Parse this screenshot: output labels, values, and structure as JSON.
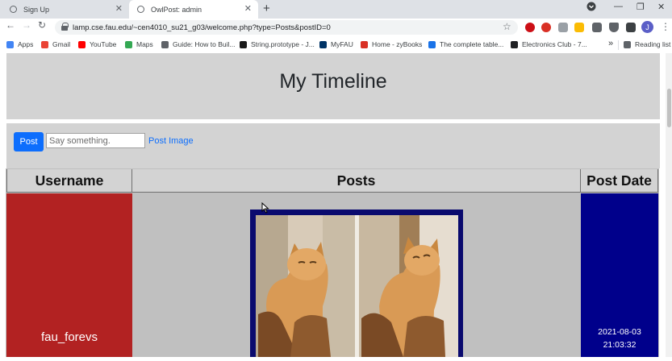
{
  "browser": {
    "tabs": [
      {
        "title": "Sign Up"
      },
      {
        "title": "OwlPost: admin"
      }
    ],
    "url": "lamp.cse.fau.edu/~cen4010_su21_g03/welcome.php?type=Posts&postID=0",
    "bookmarks": [
      {
        "label": "Apps",
        "icon": "apps-grid-icon",
        "color": "#4285f4"
      },
      {
        "label": "Gmail",
        "icon": "gmail-icon",
        "color": "#ea4335"
      },
      {
        "label": "YouTube",
        "icon": "youtube-icon",
        "color": "#ff0000"
      },
      {
        "label": "Maps",
        "icon": "maps-icon",
        "color": "#34a853"
      },
      {
        "label": "Guide: How to Buil...",
        "icon": "guide-icon",
        "color": "#5f6368"
      },
      {
        "label": "String.prototype - J...",
        "icon": "mdn-icon",
        "color": "#1a1a1a"
      },
      {
        "label": "MyFAU",
        "icon": "owl-icon",
        "color": "#003366"
      },
      {
        "label": "Home - zyBooks",
        "icon": "zybooks-icon",
        "color": "#d93025"
      },
      {
        "label": "The complete table...",
        "icon": "bookmark-icon",
        "color": "#1a73e8"
      },
      {
        "label": "Electronics Club - 7...",
        "icon": "club-icon",
        "color": "#202124"
      }
    ],
    "more_bookmarks": "»",
    "reading_list": "Reading list",
    "profile_initial": "J"
  },
  "page": {
    "title": "My Timeline",
    "post_button": "Post",
    "input_placeholder": "Say something.",
    "post_image_link": "Post Image",
    "table": {
      "headers": [
        "Username",
        "Posts",
        "Post Date"
      ],
      "rows": [
        {
          "username": "fau_forevs",
          "post_date": "2021-08-03",
          "post_time": "21:03:32"
        }
      ]
    },
    "colors": {
      "username_cell": "#b22222",
      "date_cell": "#00008b",
      "post_button": "#0d6efd"
    }
  }
}
